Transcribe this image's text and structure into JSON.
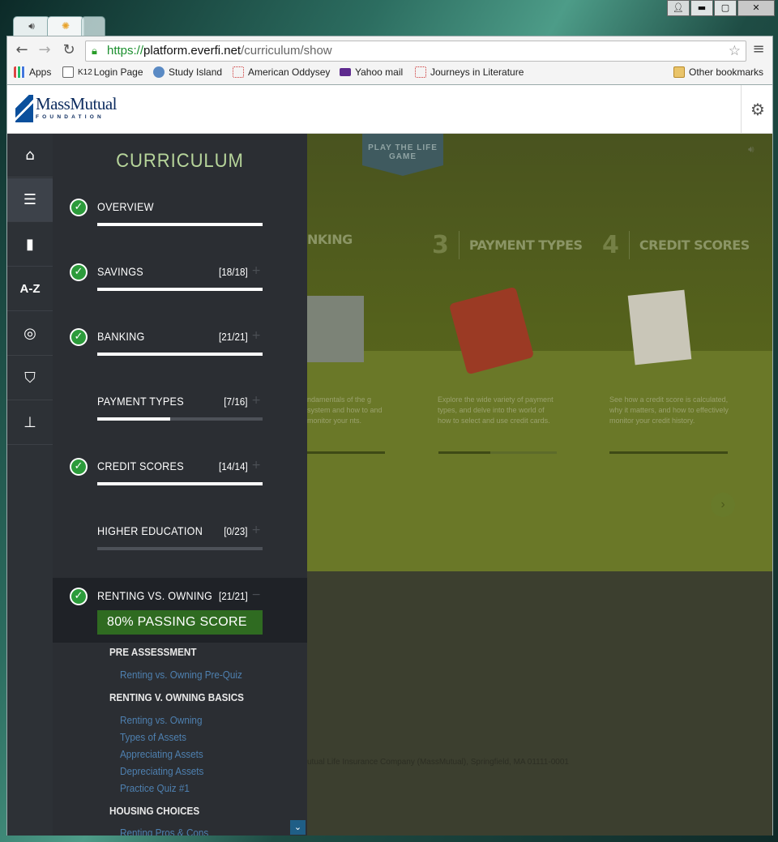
{
  "browser": {
    "url_scheme": "https://",
    "url_host": "platform.everfi.net",
    "url_path": "/curriculum/show",
    "bookmarks": [
      {
        "label": "Apps",
        "icon": "apps-grid-icon"
      },
      {
        "label": "Login Page",
        "prefix": "K12",
        "icon": "k12-icon"
      },
      {
        "label": "Study Island",
        "icon": "study-island-icon"
      },
      {
        "label": "American Oddysey",
        "icon": "american-odyssey-icon"
      },
      {
        "label": "Yahoo mail",
        "icon": "mail-icon"
      },
      {
        "label": "Journeys in Literature",
        "icon": "journeys-icon"
      },
      {
        "label": "Other bookmarks",
        "icon": "folder-icon"
      }
    ]
  },
  "header": {
    "logo_name": "MassMutual",
    "logo_sub": "FOUNDATION"
  },
  "panel": {
    "title": "CURRICULUM",
    "sections": [
      {
        "label": "OVERVIEW",
        "count": "",
        "done": true,
        "progress": 1.0,
        "toggle": ""
      },
      {
        "label": "SAVINGS",
        "count": "[18/18]",
        "done": true,
        "progress": 1.0,
        "toggle": "+"
      },
      {
        "label": "BANKING",
        "count": "[21/21]",
        "done": true,
        "progress": 1.0,
        "toggle": "+"
      },
      {
        "label": "PAYMENT TYPES",
        "count": "[7/16]",
        "done": false,
        "progress": 0.44,
        "toggle": "+"
      },
      {
        "label": "CREDIT SCORES",
        "count": "[14/14]",
        "done": true,
        "progress": 1.0,
        "toggle": "+"
      },
      {
        "label": "HIGHER EDUCATION",
        "count": "[0/23]",
        "done": false,
        "progress": 0.0,
        "toggle": "+"
      },
      {
        "label": "RENTING VS. OWNING",
        "count": "[21/21]",
        "done": true,
        "progress": 1.0,
        "toggle": "−"
      }
    ],
    "passing_score": "80% PASSING SCORE",
    "subsections": [
      {
        "heading": "PRE ASSESSMENT",
        "links": [
          "Renting vs. Owning Pre-Quiz"
        ]
      },
      {
        "heading": "RENTING V. OWNING BASICS",
        "links": [
          "Renting vs. Owning",
          "Types of Assets",
          "Appreciating Assets",
          "Depreciating Assets",
          "Practice Quiz #1"
        ]
      },
      {
        "heading": "HOUSING CHOICES",
        "links": [
          "Renting Pros & Cons"
        ]
      }
    ]
  },
  "rail": [
    "home-icon",
    "list-icon",
    "book-icon",
    "A-Z",
    "target-check-icon",
    "shield-star-icon",
    "stamp-icon"
  ],
  "background": {
    "play_life": "PLAY THE LIFE GAME",
    "modules": [
      {
        "num": "",
        "title": "NKING",
        "desc": "ndamentals of the g system and how to and monitor your nts."
      },
      {
        "num": "3",
        "title": "PAYMENT TYPES",
        "desc": "Explore the wide variety of payment types, and delve into the world of how to select and use credit cards."
      },
      {
        "num": "4",
        "title": "CREDIT SCORES",
        "desc": "See how a credit score is calculated, why it matters, and how to effectively monitor your credit history."
      }
    ],
    "footer": "utual Life Insurance Company (MassMutual), Springfield, MA 01111-0001"
  },
  "colors": {
    "accent_green": "#2c9b3b",
    "title_green": "#b6d49a",
    "link_blue": "#4e80b0",
    "panel_bg": "#2b2e33"
  }
}
